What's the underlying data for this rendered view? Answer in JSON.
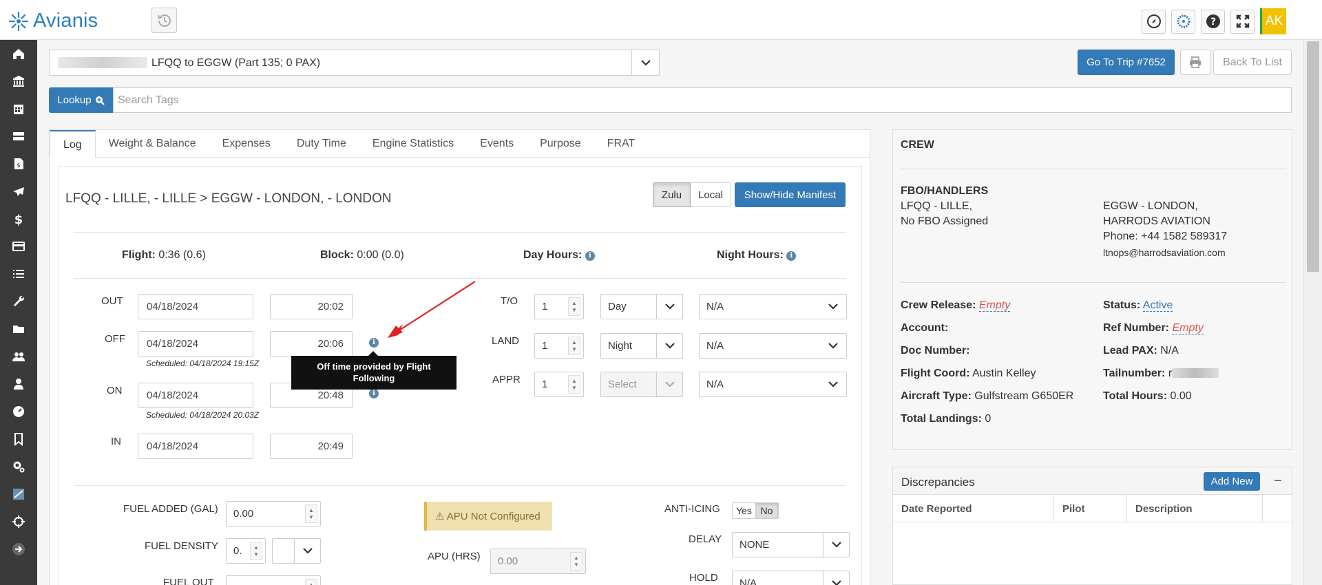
{
  "app": {
    "logo_text": "Avianis",
    "user_initials": "AK",
    "colors": {
      "primary": "#337ab7",
      "logo": "#2a7fc1",
      "sidebar": "#3a3a3a",
      "avatar": "#f2c200",
      "danger": "#d9534f",
      "warning_bg": "#f1e0b0"
    }
  },
  "topbar": {
    "icons": [
      "compass-icon",
      "avianis-icon",
      "help-icon",
      "fullscreen-icon"
    ]
  },
  "sidebar": {
    "icons": [
      "home-icon",
      "bank-icon",
      "calendar-icon",
      "server-icon",
      "invoice-icon",
      "plane-icon",
      "dollar-icon",
      "credit-card-icon",
      "list-icon",
      "wrench-icon",
      "folder-icon",
      "users-icon",
      "user-icon",
      "dashboard-icon",
      "bookmark-icon",
      "cogs-icon",
      "flight-board-icon",
      "crosshairs-icon",
      "arrow-right-icon"
    ]
  },
  "trip": {
    "selector_text": "LFQQ to EGGW (Part 135; 0 PAX)",
    "goto_label": "Go To Trip #7652",
    "back_label": "Back To List"
  },
  "lookup": {
    "button_label": "Lookup",
    "placeholder": "Search Tags"
  },
  "tabs": [
    "Log",
    "Weight & Balance",
    "Expenses",
    "Duty Time",
    "Engine Statistics",
    "Events",
    "Purpose",
    "FRAT"
  ],
  "log": {
    "route": "LFQQ - LILLE, - LILLE > EGGW - LONDON, - LONDON",
    "zulu_label": "Zulu",
    "local_label": "Local",
    "manifest_label": "Show/Hide Manifest",
    "summary": {
      "flight_label": "Flight:",
      "flight_value": "0:36 (0.6)",
      "block_label": "Block:",
      "block_value": "0:00 (0.0)",
      "day_label": "Day Hours:",
      "night_label": "Night Hours:"
    },
    "times": {
      "out": {
        "label": "OUT",
        "date": "04/18/2024",
        "time": "20:02"
      },
      "off": {
        "label": "OFF",
        "date": "04/18/2024",
        "time": "20:06",
        "scheduled": "Scheduled: 04/18/2024 19:15Z"
      },
      "on": {
        "label": "ON",
        "date": "04/18/2024",
        "time": "20:48",
        "scheduled": "Scheduled: 04/18/2024 20:03Z"
      },
      "in": {
        "label": "IN",
        "date": "04/18/2024",
        "time": "20:49"
      }
    },
    "tooltip": "Off time provided by Flight Following",
    "landings": {
      "to": {
        "label": "T/O",
        "count": "1",
        "period": "Day",
        "extra": "N/A"
      },
      "land": {
        "label": "LAND",
        "count": "1",
        "period": "Night",
        "extra": "N/A"
      },
      "appr": {
        "label": "APPR",
        "count": "1",
        "period": "Select",
        "extra": "N/A"
      }
    },
    "fuel": {
      "added_label": "FUEL ADDED (GAL)",
      "added_value": "0.00",
      "density_label": "FUEL DENSITY",
      "density_value": "0.",
      "out_label": "FUEL OUT"
    },
    "apu": {
      "warning": "APU Not Configured",
      "hours_label": "APU (HRS)",
      "hours_value": "0.00"
    },
    "anti_icing": {
      "label": "ANTI-ICING",
      "yes": "Yes",
      "no": "No",
      "selected": "No"
    },
    "delay": {
      "label": "DELAY",
      "value": "NONE"
    },
    "hold": {
      "label": "HOLD",
      "value": "N/A"
    }
  },
  "crew": {
    "title": "CREW",
    "fbo_title": "FBO/HANDLERS",
    "fbo_left": {
      "line1": "LFQQ - LILLE,",
      "line2": "No FBO Assigned"
    },
    "fbo_right": {
      "line1": "EGGW - LONDON,",
      "line2": "HARRODS AVIATION",
      "phone": "Phone: +44 1582 589317",
      "email": "ltnops@harrodsaviation.com"
    },
    "crew_release_label": "Crew Release:",
    "crew_release_value": "Empty",
    "status_label": "Status:",
    "status_value": "Active",
    "account_label": "Account:",
    "ref_label": "Ref Number:",
    "ref_value": "Empty",
    "doc_label": "Doc Number:",
    "lead_pax_label": "Lead PAX:",
    "lead_pax_value": "N/A",
    "coord_label": "Flight Coord:",
    "coord_value": "Austin Kelley",
    "tail_label": "Tailnumber:",
    "tail_value": "r",
    "aircraft_label": "Aircraft Type:",
    "aircraft_value": "Gulfstream G650ER",
    "total_hours_label": "Total Hours:",
    "total_hours_value": "0.00",
    "landings_label": "Total Landings:",
    "landings_value": "0"
  },
  "discrepancies": {
    "title": "Discrepancies",
    "add_label": "Add New",
    "columns": [
      "Date Reported",
      "Pilot",
      "Description"
    ]
  }
}
